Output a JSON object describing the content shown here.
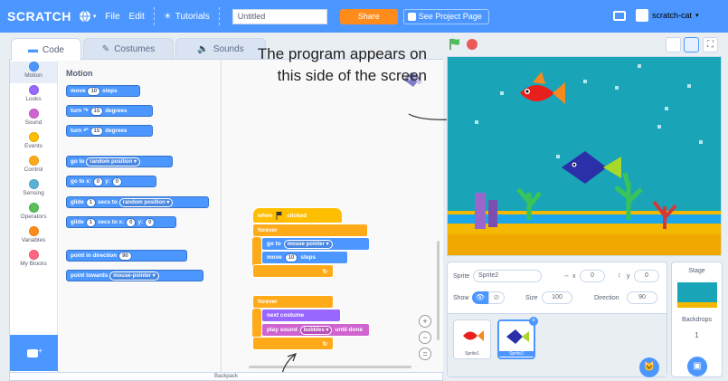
{
  "menubar": {
    "logo": "SCRATCH",
    "file": "File",
    "edit": "Edit",
    "tutorials": "Tutorials",
    "project_title": "Untitled",
    "share": "Share",
    "see_project": "See Project Page",
    "username": "scratch-cat"
  },
  "tabs": {
    "code": "Code",
    "costumes": "Costumes",
    "sounds": "Sounds"
  },
  "categories": [
    {
      "label": "Motion",
      "color": "#4c97ff"
    },
    {
      "label": "Looks",
      "color": "#9966ff"
    },
    {
      "label": "Sound",
      "color": "#cf63cf"
    },
    {
      "label": "Events",
      "color": "#ffbf00"
    },
    {
      "label": "Control",
      "color": "#ffab19"
    },
    {
      "label": "Sensing",
      "color": "#5cb1d6"
    },
    {
      "label": "Operators",
      "color": "#59c059"
    },
    {
      "label": "Variables",
      "color": "#ff8c1a"
    },
    {
      "label": "My Blocks",
      "color": "#ff6680"
    }
  ],
  "palette": {
    "heading": "Motion",
    "move": "move",
    "move_val": "10",
    "steps": "steps",
    "turn": "turn",
    "turn_val": "15",
    "degrees": "degrees",
    "goto": "go to",
    "random_position": "random position ▾",
    "goto_xy": "go to x:",
    "x_val": "0",
    "y_lbl": "y:",
    "y_val": "0",
    "glide": "glide",
    "glide_val": "1",
    "secs_to": "secs to",
    "secs_to_x": "secs to x:",
    "point_dir": "point in direction",
    "dir_val": "90",
    "point_towards": "point towards",
    "mouse_pointer": "mouse-pointer ▾"
  },
  "script": {
    "when": "when",
    "clicked": "clicked",
    "forever": "forever",
    "goto": "go to",
    "mouse_pointer": "mouse pointer ▾",
    "move": "move",
    "move_val": "10",
    "steps": "steps",
    "forever2": "forever",
    "next_costume": "next costume",
    "play_sound": "play sound",
    "sound_name": "bubbles ▾",
    "until_done": "until done"
  },
  "annotation": "The program appears on this side of the screen",
  "backpack": "Backpack",
  "sprite_info": {
    "sprite_label": "Sprite",
    "sprite_name": "Sprite2",
    "x_label": "x",
    "x_val": "0",
    "y_label": "y",
    "y_val": "0",
    "show_label": "Show",
    "size_label": "Size",
    "size_val": "100",
    "direction_label": "Direction",
    "direction_val": "90"
  },
  "sprites": [
    {
      "name": "Sprite1"
    },
    {
      "name": "Sprite2"
    }
  ],
  "stage_panel": {
    "title": "Stage",
    "backdrops_label": "Backdrops",
    "backdrops_count": "1"
  }
}
